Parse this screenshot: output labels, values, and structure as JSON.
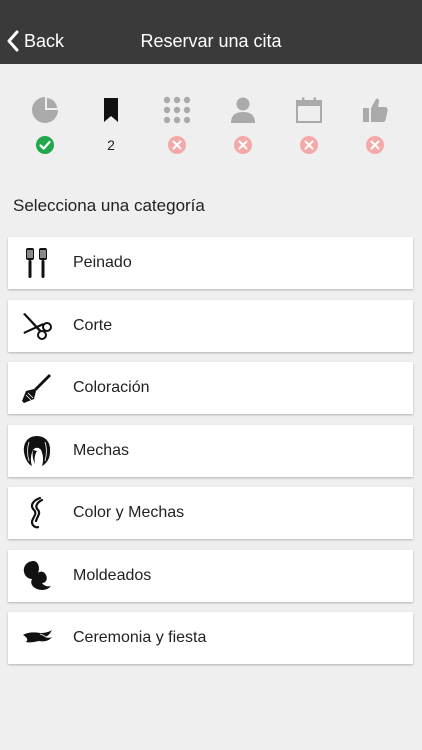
{
  "nav": {
    "back_label": "Back",
    "title": "Reservar una cita"
  },
  "steps": [
    {
      "icon": "pie-chart-icon",
      "status": "done",
      "color": "#aaaaaa"
    },
    {
      "icon": "bookmark-icon",
      "status": "current",
      "label": "2",
      "color": "#111111"
    },
    {
      "icon": "grid-icon",
      "status": "pending",
      "color": "#aaaaaa"
    },
    {
      "icon": "person-icon",
      "status": "pending",
      "color": "#aaaaaa"
    },
    {
      "icon": "calendar-icon",
      "status": "pending",
      "color": "#aaaaaa"
    },
    {
      "icon": "thumbs-up-icon",
      "status": "pending",
      "color": "#aaaaaa"
    }
  ],
  "colors": {
    "done": "#22a84a",
    "pending": "#f4a9a9",
    "navbar": "#3a3a3a"
  },
  "heading": "Selecciona una categoría",
  "categories": [
    {
      "label": "Peinado",
      "icon": "brush-icon"
    },
    {
      "label": "Corte",
      "icon": "scissors-icon"
    },
    {
      "label": "Coloración",
      "icon": "dye-brush-icon"
    },
    {
      "label": "Mechas",
      "icon": "hair-highlights-icon"
    },
    {
      "label": "Color y Mechas",
      "icon": "hair-strand-icon"
    },
    {
      "label": "Moldeados",
      "icon": "curly-hair-icon"
    },
    {
      "label": "Ceremonia y fiesta",
      "icon": "hair-updo-icon"
    }
  ]
}
